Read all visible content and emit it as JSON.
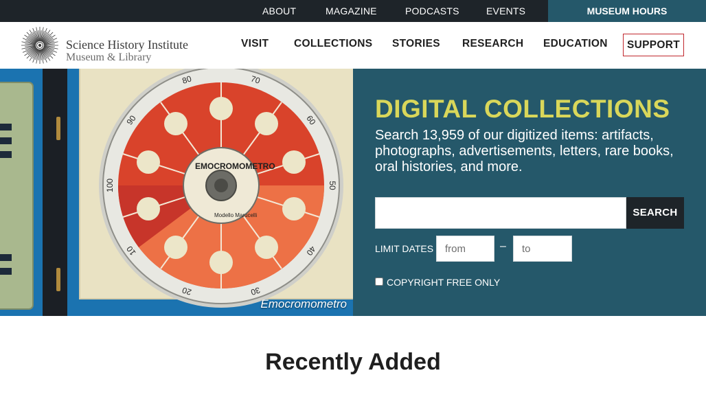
{
  "utility": {
    "links": [
      "ABOUT",
      "MAGAZINE",
      "PODCASTS",
      "EVENTS"
    ],
    "hours_label": "MUSEUM HOURS"
  },
  "logo": {
    "line1": "Science History Institute",
    "line2": "Museum & Library"
  },
  "nav": {
    "items": [
      "VISIT",
      "COLLECTIONS",
      "STORIES",
      "RESEARCH",
      "EDUCATION"
    ],
    "support_label": "SUPPORT"
  },
  "hero": {
    "caption": "Emocromometro",
    "disc_ticks": [
      "70",
      "60",
      "50",
      "40",
      "30",
      "20",
      "10",
      "100",
      "90",
      "80"
    ],
    "disc_center_text": "EMOCROMOMETRO",
    "disc_center_subtext": "Modello Marucelli",
    "title": "DIGITAL COLLECTIONS",
    "description": "Search 13,959 of our digitized items: artifacts, photographs, advertisements, letters, rare books, oral histories, and more.",
    "search_value": "",
    "search_label": "SEARCH",
    "limit_label": "LIMIT DATES",
    "from_placeholder": "from",
    "to_placeholder": "to",
    "dash": "–",
    "copyright_label": "COPYRIGHT FREE ONLY",
    "copyright_checked": false
  },
  "recent": {
    "title": "Recently Added"
  },
  "colors": {
    "utility_bg": "#1e2429",
    "accent_teal": "#25586a",
    "title_yellow": "#d9d75a",
    "support_border": "#c0272d"
  }
}
